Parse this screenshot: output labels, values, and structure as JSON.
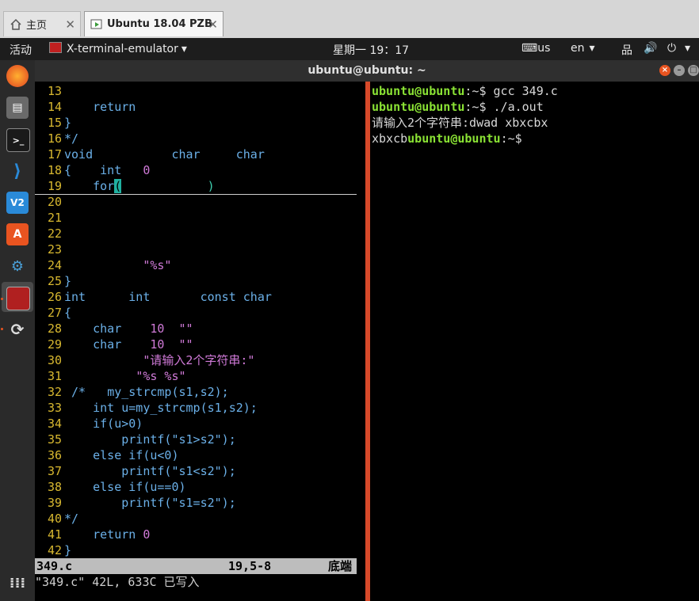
{
  "tabs": [
    {
      "label": "主页",
      "icon": "home-icon"
    },
    {
      "label": "Ubuntu 18.04 PZB",
      "icon": "vm-icon"
    }
  ],
  "panel": {
    "activities": "活动",
    "app_name": "X-terminal-emulator",
    "clock": "星期一 19：17",
    "keyboard": "us",
    "lang": "en"
  },
  "window_title": "ubuntu@ubuntu: ~",
  "vim": {
    "filename": "349.c",
    "position": "19,5-8",
    "scroll": "底端",
    "message": "\"349.c\" 42L, 633C 已写入"
  },
  "terminal": {
    "prompt": "ubuntu@ubuntu",
    "path": ":~$",
    "cmd1": " gcc 349.c",
    "cmd2": " ./a.out",
    "out1": "请输入2个字符串:dwad xbxcbx",
    "out2": "xbxcb"
  },
  "accent": "#e95420"
}
